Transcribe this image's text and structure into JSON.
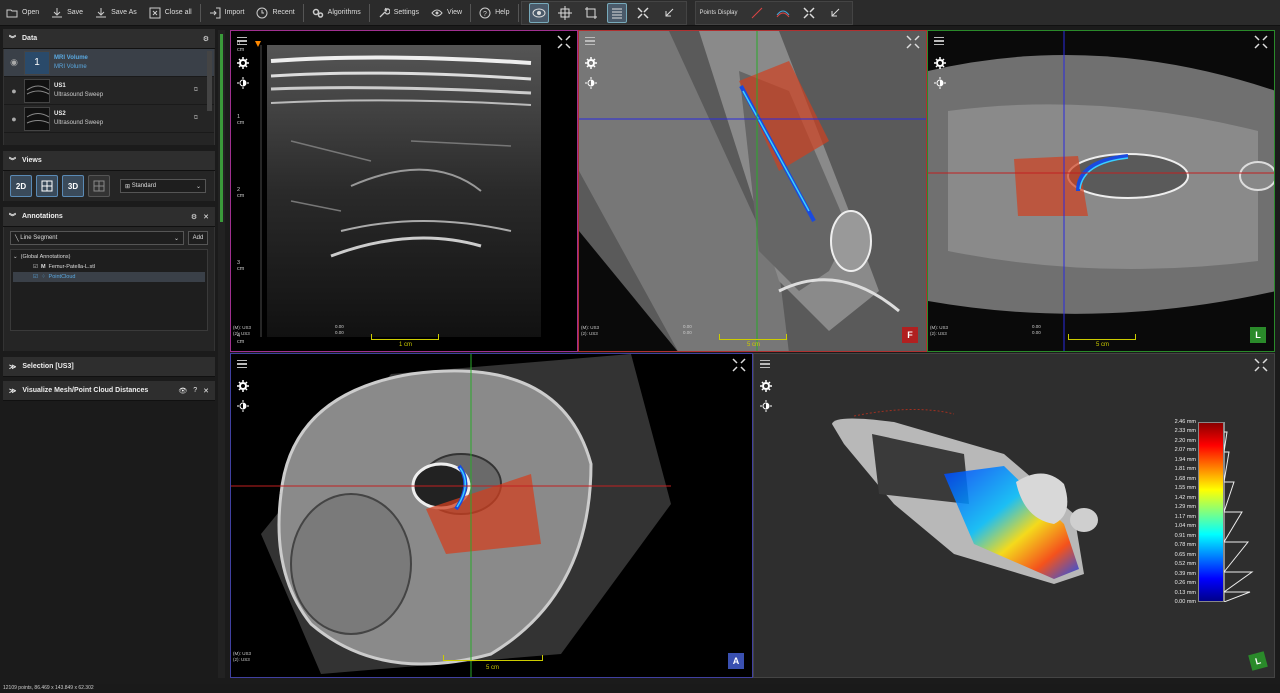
{
  "toolbar": {
    "open": "Open",
    "save": "Save",
    "save_as": "Save As",
    "close_all": "Close all",
    "import": "Import",
    "recent": "Recent",
    "algorithms": "Algorithms",
    "settings": "Settings",
    "view": "View",
    "help": "Help",
    "points_display": "Points Display"
  },
  "data_panel": {
    "title": "Data",
    "items": [
      {
        "name": "MRI Volume",
        "subtitle": "MRI Volume",
        "selected": true,
        "badge": "1"
      },
      {
        "name": "US1",
        "subtitle": "Ultrasound Sweep",
        "selected": false
      },
      {
        "name": "US2",
        "subtitle": "Ultrasound Sweep",
        "selected": false
      }
    ]
  },
  "views_panel": {
    "title": "Views",
    "btn_2d": "2D",
    "btn_3d": "3D",
    "layout": "Standard"
  },
  "annotations_panel": {
    "title": "Annotations",
    "type": "Line Segment",
    "add": "Add",
    "group": "(Global Annotations)",
    "items": [
      {
        "label": "Femur-Patella-L.stl"
      },
      {
        "label": "PointCloud"
      }
    ]
  },
  "selection_panel": {
    "title": "Selection [US3]"
  },
  "distances_panel": {
    "title": "Visualize Mesh/Point Cloud Distances",
    "help": "?"
  },
  "viewports": {
    "us": {
      "info1": "(M): US3",
      "info2": "(2): US3",
      "coord1": "0.00",
      "coord2": "0.00",
      "scale": "1 cm",
      "ruler": [
        "0 cm",
        "1 cm",
        "2 cm",
        "3 cm",
        "4 cm"
      ]
    },
    "frontal": {
      "info1": "(M): US3",
      "info2": "(2): US3",
      "coord1": "0.00",
      "coord2": "0.00",
      "scale": "5 cm",
      "badge": "F"
    },
    "lateral": {
      "info1": "(M): US3",
      "info2": "(2): US3",
      "coord1": "0.00",
      "coord2": "0.00",
      "scale": "5 cm",
      "badge": "L"
    },
    "axial": {
      "info1": "(M): US3",
      "info2": "(2): US3",
      "scale": "5 cm",
      "badge": "A"
    },
    "view3d": {
      "badge": "L"
    }
  },
  "legend": {
    "labels": [
      "2.46 mm",
      "2.33 mm",
      "2.20 mm",
      "2.07 mm",
      "1.94 mm",
      "1.81 mm",
      "1.68 mm",
      "1.55 mm",
      "1.42 mm",
      "1.29 mm",
      "1.17 mm",
      "1.04 mm",
      "0.91 mm",
      "0.78 mm",
      "0.65 mm",
      "0.52 mm",
      "0.39 mm",
      "0.26 mm",
      "0.13 mm",
      "0.00 mm"
    ]
  },
  "status": "12109 points, 86.469 x 143.849 x 62.302",
  "colors": {
    "frontal_border": "#b03030",
    "lateral_border": "#2a8a2a",
    "axial_border": "#4040a0",
    "active_border": "#a03090"
  }
}
